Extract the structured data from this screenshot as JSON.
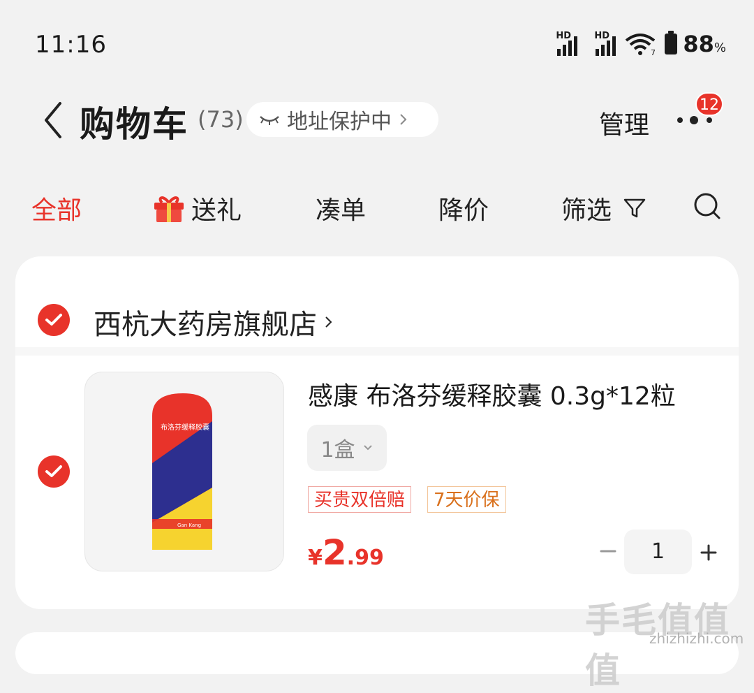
{
  "status_bar": {
    "time": "11:16",
    "signal1_label": "HD",
    "signal2_label": "HD",
    "wifi_sub": "7",
    "battery_value": "88",
    "battery_unit": "%"
  },
  "header": {
    "title": "购物车",
    "count": "(73)",
    "address_protect": "地址保护中",
    "manage": "管理",
    "more_badge": "12"
  },
  "tabs": [
    {
      "label": "全部",
      "active": true
    },
    {
      "label": "送礼",
      "icon": "gift-icon"
    },
    {
      "label": "凑单"
    },
    {
      "label": "降价"
    },
    {
      "label": "筛选",
      "icon": "filter-icon"
    }
  ],
  "store": {
    "name": "西杭大药房旗舰店"
  },
  "product": {
    "title": "感康 布洛芬缓释胶囊 0.3g*12粒",
    "spec": "1盒",
    "tags": [
      "买贵双倍赔",
      "7天价保"
    ],
    "price_currency": "¥",
    "price_int": "2",
    "price_dec": ".99",
    "quantity": "1",
    "package_text": "布洛芬缓释胶囊",
    "package_brand": "Gan Kang"
  },
  "watermark": {
    "text": "手毛值值值",
    "url": "zhizhizhi.com"
  },
  "colors": {
    "accent": "#e8332a",
    "tag_orange": "#d9701c",
    "background": "#f2f2f2"
  }
}
